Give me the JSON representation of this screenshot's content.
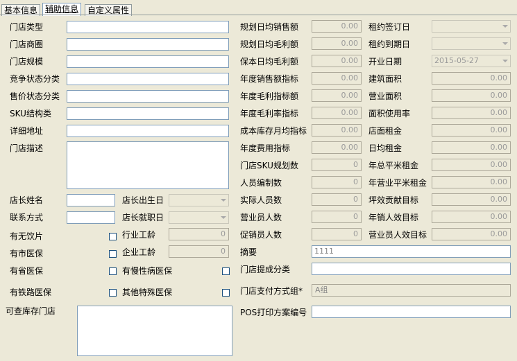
{
  "tabs": [
    {
      "label": "基本信息"
    },
    {
      "label": "辅助信息"
    },
    {
      "label": "自定义属性"
    }
  ],
  "left": {
    "store_type": "门店类型",
    "store_area": "门店商圈",
    "store_scale": "门店规模",
    "competition": "竞争状态分类",
    "price_status": "售价状态分类",
    "sku_struct": "SKU结构类",
    "address": "详细地址",
    "description": "门店描述",
    "manager_name": "店长姓名",
    "contact": "联系方式",
    "manager_birth": "店长出生日",
    "manager_start": "店长就职日",
    "no_drink": "有无饮片",
    "industry_age": "行业工龄",
    "industry_age_val": "0",
    "city_ins": "有市医保",
    "company_age": "企业工龄",
    "company_age_val": "0",
    "province_ins": "有省医保",
    "chronic_ins": "有慢性病医保",
    "railway_ins": "有铁路医保",
    "other_ins": "其他特殊医保",
    "query_stock": "可查库存门店"
  },
  "middle": {
    "rows": [
      {
        "label": "规划日均销售额",
        "value": "0.00"
      },
      {
        "label": "规划日均毛利额",
        "value": "0.00"
      },
      {
        "label": "保本日均毛利额",
        "value": "0.00"
      },
      {
        "label": "年度销售额指标",
        "value": "0.00"
      },
      {
        "label": "年度毛利指标额",
        "value": "0.00"
      },
      {
        "label": "年度毛利率指标",
        "value": "0.00"
      },
      {
        "label": "成本库存月均指标",
        "value": "0.00"
      },
      {
        "label": "年度费用指标",
        "value": "0.00"
      },
      {
        "label": "门店SKU规划数",
        "value": "0"
      },
      {
        "label": "人员编制数",
        "value": "0"
      },
      {
        "label": "实际人员数",
        "value": "0"
      },
      {
        "label": "营业员人数",
        "value": "0"
      },
      {
        "label": "促销员人数",
        "value": "0"
      }
    ],
    "summary_label": "摘要",
    "summary_value": "1111",
    "commission_label": "门店提成分类",
    "payment_label": "门店支付方式组*",
    "payment_value": "A组",
    "pos_label": "POS打印方案编号"
  },
  "right": {
    "lease_sign": "租约签订日",
    "lease_end": "租约到期日",
    "open_date_label": "开业日期",
    "open_date_value": "2015-05-27",
    "rows": [
      {
        "label": "建筑面积",
        "value": "0.00"
      },
      {
        "label": "营业面积",
        "value": "0.00"
      },
      {
        "label": "面积使用率",
        "value": "0.00"
      },
      {
        "label": "店面租金",
        "value": "0.00"
      },
      {
        "label": "日均租金",
        "value": "0.00"
      },
      {
        "label": "年总平米租金",
        "value": "0.00"
      },
      {
        "label": "年营业平米租金",
        "value": "0.00"
      },
      {
        "label": "坪效贡献目标",
        "value": "0.00"
      },
      {
        "label": "年销人效目标",
        "value": "0.00"
      },
      {
        "label": "营业员人效目标",
        "value": "0.00"
      }
    ]
  }
}
